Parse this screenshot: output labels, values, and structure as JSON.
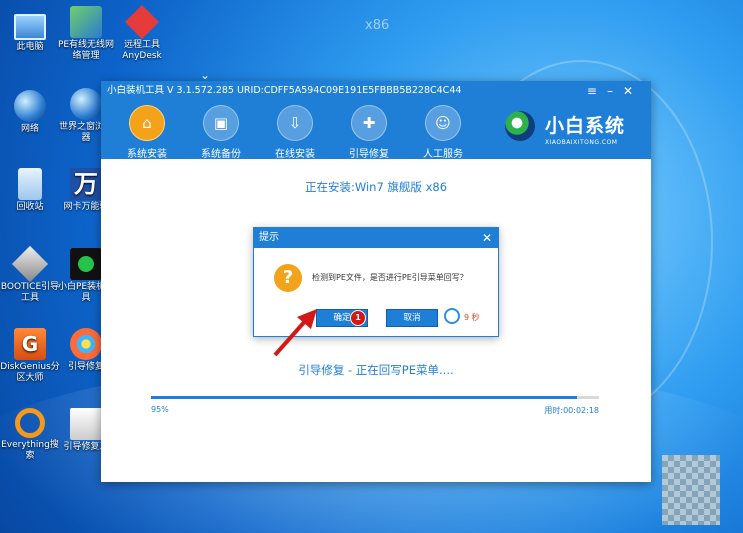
{
  "desktop": {
    "watermark": "x86",
    "icons": [
      {
        "label": "此电脑"
      },
      {
        "label": "PE有线无线网络管理"
      },
      {
        "label": "远程工具 AnyDesk"
      },
      {
        "label": "网络"
      },
      {
        "label": "世界之窗浏览器"
      },
      {
        "label": "回收站"
      },
      {
        "label": "网卡万能驱"
      },
      {
        "label": "BOOTICE引导工具"
      },
      {
        "label": "小白PE装机工具"
      },
      {
        "label": "DiskGenius分区大师"
      },
      {
        "label": "引导修复"
      },
      {
        "label": "Everything搜索"
      },
      {
        "label": "引导修复工"
      }
    ]
  },
  "app": {
    "title": "小白装机工具 V 3.1.572.285 URID:CDFF5A594C09E191E5FBBB5B228C4C44",
    "brand": {
      "name": "小白系统",
      "sub": "XIAOBAIXITONG.COM"
    },
    "nav": [
      {
        "label": "系统安装",
        "icon": "⌂"
      },
      {
        "label": "系统备份",
        "icon": "▣"
      },
      {
        "label": "在线安装",
        "icon": "⇩"
      },
      {
        "label": "引导修复",
        "icon": "✚"
      },
      {
        "label": "人工服务",
        "icon": "☺"
      }
    ],
    "installing": "正在安装:Win7 旗舰版 x86",
    "status": "引导修复 - 正在回写PE菜单....",
    "progress": {
      "percent_label": "95%",
      "value": 0.95,
      "elapsed": "用时:00:02:18"
    }
  },
  "dialog": {
    "title": "提示",
    "close": "✕",
    "message": "检测到PE文件，是否进行PE引导菜单回写？",
    "ok": "确定",
    "cancel": "取消",
    "countdown": "9 秒",
    "badge": "1"
  },
  "colors": {
    "accent": "#1f7fd6",
    "warning": "#f3a21b",
    "badge": "#d41818"
  }
}
